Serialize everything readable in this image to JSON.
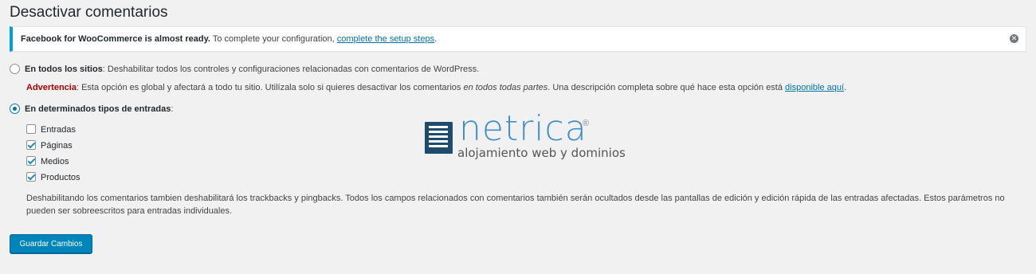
{
  "page": {
    "title": "Desactivar comentarios"
  },
  "notice": {
    "bold": "Facebook for WooCommerce is almost ready.",
    "text": " To complete your configuration, ",
    "link": "complete the setup steps",
    "end": ".",
    "dismiss_icon": "✕"
  },
  "option_all": {
    "label": "En todos los sitios",
    "desc": ": Deshabilitar todos los controles y configuraciones relacionadas con comentarios de WordPress.",
    "selected": false
  },
  "warning": {
    "label": "Advertencia",
    "text1": ": Esta opción es global y afectará a todo tu sitio. Utilízala solo si quieres desactivar los comentarios ",
    "italic": "en todos todas partes",
    "text2": ". Una descripción completa sobre qué hace esta opción está ",
    "link": "disponible aquí",
    "end": "."
  },
  "option_types": {
    "label": "En determinados tipos de entradas",
    "colon": ":",
    "selected": true
  },
  "post_types": [
    {
      "label": "Entradas",
      "checked": false
    },
    {
      "label": "Páginas",
      "checked": true
    },
    {
      "label": "Medios",
      "checked": true
    },
    {
      "label": "Productos",
      "checked": true
    }
  ],
  "description": "Deshabilitando los comentarios tambien deshabilitará los trackbacks y pingbacks. Todos los campos relacionados con comentarios también serán ocultados desde las pantallas de edición y edición rápida de las entradas afectadas. Estos parámetros no pueden ser sobreescritos para entradas individuales.",
  "save_button": "Guardar Cambios",
  "watermark": {
    "word": "netrica",
    "reg": "®",
    "tagline": "alojamiento web y dominios",
    "color": "#3e8fc6",
    "mark_color": "#1f4b6c"
  }
}
